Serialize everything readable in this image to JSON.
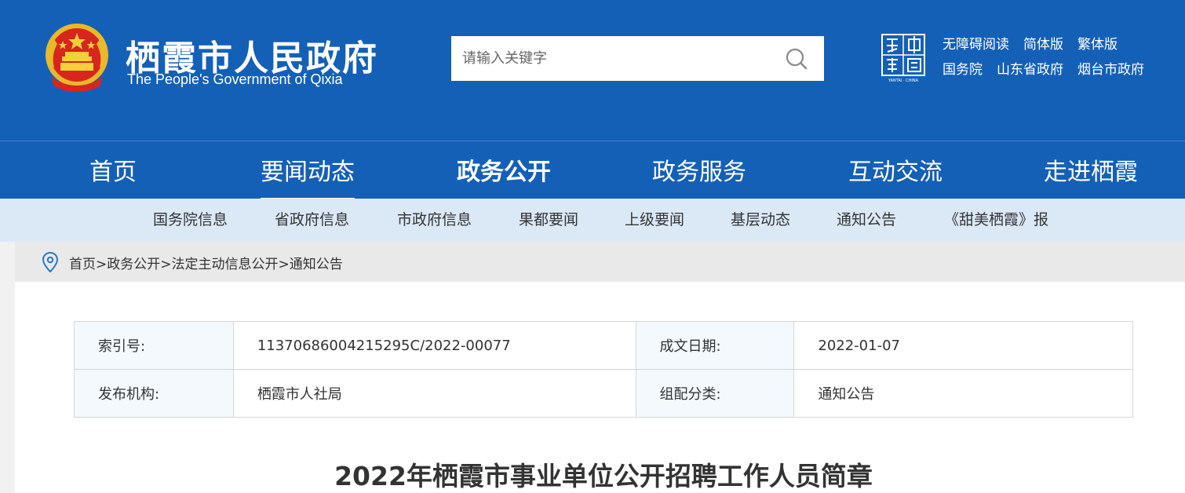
{
  "header": {
    "title": "栖霞市人民政府",
    "subtitle": "The People's Government of Qixia",
    "search_placeholder": "请输入关键字",
    "top_links_row1": [
      "无障碍阅读",
      "简体版",
      "繁体版"
    ],
    "top_links_row2": [
      "国务院",
      "山东省政府",
      "烟台市政府"
    ],
    "logo_yantai_text": "YANTAI · CHINA"
  },
  "main_nav": [
    "首页",
    "要闻动态",
    "政务公开",
    "政务服务",
    "互动交流",
    "走进栖霞"
  ],
  "sub_nav": [
    "国务院信息",
    "省政府信息",
    "市政府信息",
    "果都要闻",
    "上级要闻",
    "基层动态",
    "通知公告",
    "《甜美栖霞》报"
  ],
  "breadcrumb": [
    "首页",
    "政务公开",
    "法定主动信息公开",
    "通知公告"
  ],
  "breadcrumb_sep": ">",
  "info": {
    "index_label": "索引号:",
    "index_value": "11370686004215295C/2022-00077",
    "date_label": "成文日期:",
    "date_value": "2022-01-07",
    "org_label": "发布机构:",
    "org_value": "栖霞市人社局",
    "category_label": "组配分类:",
    "category_value": "通知公告"
  },
  "article_title": "2022年栖霞市事业单位公开招聘工作人员简章",
  "colors": {
    "header_blue": "#1560b7",
    "subnav_bg": "#dbe9f7",
    "table_label_bg": "#f3f9fd"
  }
}
